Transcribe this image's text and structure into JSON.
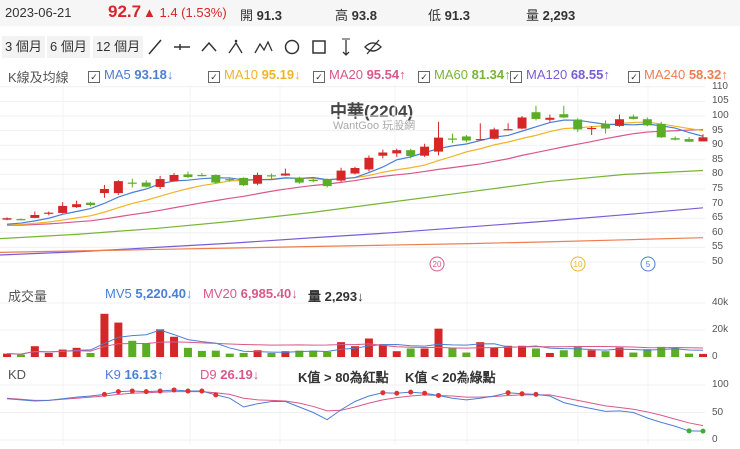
{
  "header": {
    "date": "2023-06-21",
    "price": "92.7",
    "change": "▲ 1.4 (1.53%)",
    "open_label": "開",
    "open": "91.3",
    "high_label": "高",
    "high": "93.8",
    "low_label": "低",
    "low": "91.3",
    "volume_label": "量",
    "volume": "2,293"
  },
  "toolbar": {
    "ranges": [
      "3 個月",
      "6 個月",
      "12 個月"
    ],
    "tools": [
      "line-tool-icon",
      "horizontal-line-tool-icon",
      "angle-tool-icon",
      "abc-pattern-tool-icon",
      "abcd-pattern-tool-icon",
      "circle-tool-icon",
      "rectangle-tool-icon",
      "text-tool-icon",
      "hide-drawings-icon"
    ]
  },
  "ma_legend": {
    "title": "K線及均線",
    "items": [
      {
        "name": "MA5",
        "value": "93.18↓",
        "color": "#4a7fd4"
      },
      {
        "name": "MA10",
        "value": "95.19↓",
        "color": "#f0b429"
      },
      {
        "name": "MA20",
        "value": "95.54↑",
        "color": "#d9588a"
      },
      {
        "name": "MA60",
        "value": "81.34↑",
        "color": "#78b534"
      },
      {
        "name": "MA120",
        "value": "68.55↑",
        "color": "#7a5dd6"
      },
      {
        "name": "MA240",
        "value": "58.32↑",
        "color": "#ee7d4f"
      }
    ]
  },
  "chart_title": "中華(2204)",
  "watermark": "WantGoo 玩股網",
  "colors": {
    "up": "#d62728",
    "down": "#5aad25"
  },
  "chart_data": {
    "type": "candlestick",
    "price_axis": {
      "ticks": [
        110,
        105,
        100,
        95,
        90,
        85,
        80,
        75,
        70,
        65,
        60,
        55,
        50
      ],
      "range": [
        50,
        110
      ]
    },
    "ohlc": [
      [
        64.5,
        65.3,
        64.3,
        65
      ],
      [
        64.7,
        64.9,
        64.3,
        64.5
      ],
      [
        65.1,
        67.3,
        65,
        66.1
      ],
      [
        66.5,
        67.3,
        66,
        66.9
      ],
      [
        66.8,
        70.5,
        66.6,
        69.2
      ],
      [
        68.8,
        71,
        68.5,
        69.8
      ],
      [
        70.3,
        70.6,
        69,
        69.5
      ],
      [
        73.6,
        76.4,
        72,
        75
      ],
      [
        73.6,
        78,
        73,
        77.7
      ],
      [
        77.2,
        78.5,
        75.5,
        77
      ],
      [
        77.2,
        78,
        75.5,
        75.8
      ],
      [
        75.7,
        79.5,
        75,
        78.4
      ],
      [
        77.7,
        80.5,
        77.5,
        79.8
      ],
      [
        80,
        81,
        78.8,
        79.1
      ],
      [
        79.8,
        80.5,
        79.3,
        79.6
      ],
      [
        79.8,
        80,
        76.8,
        77.2
      ],
      [
        78.4,
        79,
        77.5,
        78.2
      ],
      [
        78.8,
        79,
        76,
        76.3
      ],
      [
        76.8,
        80.6,
        76.3,
        79.8
      ],
      [
        79.7,
        80.3,
        78.5,
        79.5
      ],
      [
        79.6,
        82,
        79.5,
        80.3
      ],
      [
        78.8,
        79.2,
        76.8,
        77.2
      ],
      [
        78.1,
        78.6,
        77.3,
        77.9
      ],
      [
        78.3,
        78.6,
        75.5,
        76
      ],
      [
        77.9,
        82.3,
        77.5,
        81.3
      ],
      [
        80.3,
        82.6,
        80,
        82.2
      ],
      [
        81.7,
        86.5,
        81,
        85.7
      ],
      [
        86.4,
        88.5,
        85.5,
        87.5
      ],
      [
        87.2,
        88.8,
        86,
        88.3
      ],
      [
        88.3,
        88.8,
        85.5,
        86.3
      ],
      [
        86.4,
        90.5,
        86,
        89.5
      ],
      [
        87.8,
        98,
        86.5,
        92.6
      ],
      [
        92.3,
        94,
        90.8,
        92.1
      ],
      [
        93,
        93.5,
        91,
        91.6
      ],
      [
        91.9,
        97.5,
        91.8,
        92.1
      ],
      [
        92.2,
        96,
        92,
        95.4
      ],
      [
        95.3,
        97.5,
        95.2,
        95.5
      ],
      [
        95.7,
        100,
        95.5,
        99.5
      ],
      [
        101.3,
        103.5,
        98.5,
        99
      ],
      [
        98.7,
        100.5,
        98,
        99.4
      ],
      [
        100.6,
        103.5,
        99.3,
        99.5
      ],
      [
        98.8,
        99.2,
        94.5,
        95.4
      ],
      [
        95.7,
        96.5,
        93.5,
        95.9
      ],
      [
        97.2,
        98.5,
        94,
        95.7
      ],
      [
        96.6,
        100.5,
        96.3,
        98.9
      ],
      [
        99.8,
        100.5,
        98.8,
        99
      ],
      [
        98.9,
        99.5,
        96.5,
        96.8
      ],
      [
        97.3,
        98,
        92.5,
        92.7
      ],
      [
        92.4,
        93,
        91.6,
        91.9
      ],
      [
        92.1,
        92.8,
        91.1,
        91.2
      ],
      [
        91.3,
        93.8,
        91.3,
        92.7
      ]
    ],
    "long_ma": {
      "MA60": [
        58,
        59.5,
        61.5,
        64,
        67,
        70.5,
        74,
        77.5,
        80,
        81.34
      ],
      "MA120": [
        52.4,
        53.5,
        55,
        56.5,
        58.3,
        60,
        62,
        64,
        66.2,
        68.55
      ],
      "MA240": [
        53.3,
        53.8,
        54.3,
        54.8,
        55.3,
        55.8,
        56.3,
        56.9,
        57.6,
        58.32
      ]
    },
    "ma_markers": [
      "20",
      "10",
      "5"
    ],
    "volume": {
      "label": "成交量",
      "mv5": "5,220.40↓",
      "mv20": "6,985.40↓",
      "vol": "量 2,293↓",
      "mv5_label": "MV5",
      "mv20_label": "MV20",
      "ticks": [
        "40k",
        "20k",
        "0"
      ],
      "max": 40,
      "values_k": [
        2.5,
        1.8,
        8,
        3,
        5.5,
        6.8,
        3,
        32,
        25.5,
        12,
        10,
        20.5,
        15,
        6.8,
        4.5,
        4.7,
        2.5,
        3,
        5,
        3,
        4.3,
        4.7,
        4.7,
        3.8,
        11,
        8,
        13.7,
        9.5,
        4.3,
        6.3,
        6.3,
        21,
        7,
        3.3,
        11,
        6.8,
        8.3,
        8.3,
        6.3,
        3,
        5,
        8,
        5,
        4.3,
        7,
        3.3,
        5.8,
        7.5,
        6.8,
        2.5,
        2.3
      ]
    },
    "kd": {
      "label": "KD",
      "k_label": "K9",
      "k_value": "16.13↑",
      "d_label": "D9",
      "d_value": "26.19↓",
      "note1": "K值 > 80為紅點",
      "note2": "K值 < 20為綠點",
      "ticks": [
        "100",
        "50",
        "0"
      ],
      "k": [
        75,
        73,
        71,
        72,
        75,
        78,
        80,
        83,
        88,
        89,
        88,
        89,
        91,
        89,
        89,
        82,
        76,
        60,
        66,
        70,
        70,
        60,
        50,
        37,
        55,
        70,
        80,
        86,
        85,
        87,
        85,
        81,
        76,
        73,
        76,
        80,
        86,
        84,
        83,
        80,
        68,
        62,
        57,
        52,
        53,
        50,
        40,
        32,
        25,
        16.5,
        16.13
      ],
      "d": [
        76,
        74,
        72,
        72,
        74,
        76,
        78,
        80,
        83,
        85,
        86,
        87,
        88,
        88,
        88,
        86,
        83,
        76,
        73,
        72,
        71,
        67,
        61,
        53,
        54,
        60,
        67,
        73,
        77,
        80,
        82,
        81,
        80,
        78,
        78,
        79,
        81,
        82,
        82,
        82,
        77,
        72,
        67,
        62,
        59,
        56,
        51,
        45,
        38,
        31,
        26.19
      ]
    }
  }
}
